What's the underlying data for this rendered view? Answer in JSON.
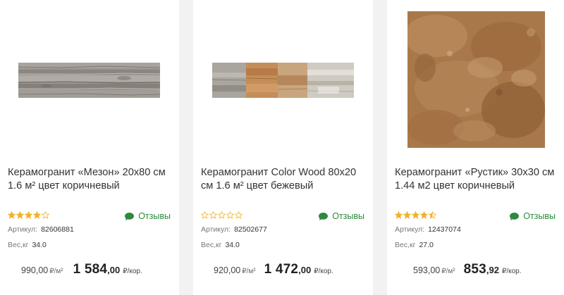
{
  "products": [
    {
      "title": "Керамогранит «Мезон» 20x80 см 1.6 м² цвет коричневый",
      "rating_stars": 4,
      "reviews_label": "Отзывы",
      "sku_label": "Артикул:",
      "sku": "82606881",
      "weight_label": "Вес,кг",
      "weight": "34.0",
      "old_price": "990,00",
      "old_price_unit": "₽/м²",
      "price_int": "1 584",
      "price_dec": ",00",
      "price_unit": "₽/кор.",
      "image_icon": "gray-wood-tile-image"
    },
    {
      "title": "Керамогранит Color Wood 80x20 см 1.6 м² цвет бежевый",
      "rating_stars": 0,
      "reviews_label": "Отзывы",
      "sku_label": "Артикул:",
      "sku": "82502677",
      "weight_label": "Вес,кг",
      "weight": "34.0",
      "old_price": "920,00",
      "old_price_unit": "₽/м²",
      "price_int": "1 472",
      "price_dec": ",00",
      "price_unit": "₽/кор.",
      "image_icon": "multicolor-wood-tile-image"
    },
    {
      "title": "Керамогранит «Рустик» 30x30 см 1.44 м2 цвет коричневый",
      "rating_stars": 4.5,
      "reviews_label": "Отзывы",
      "sku_label": "Артикул:",
      "sku": "12437074",
      "weight_label": "Вес,кг",
      "weight": "27.0",
      "old_price": "593,00",
      "old_price_unit": "₽/м²",
      "price_int": "853",
      "price_dec": ",92",
      "price_unit": "₽/кор.",
      "image_icon": "rustic-brown-tile-image"
    }
  ],
  "colors": {
    "star_filled": "#f2b12b",
    "star_empty": "#f2b12b",
    "reviews_green": "#2d8a3e",
    "page_bg": "#f2f2f2"
  }
}
